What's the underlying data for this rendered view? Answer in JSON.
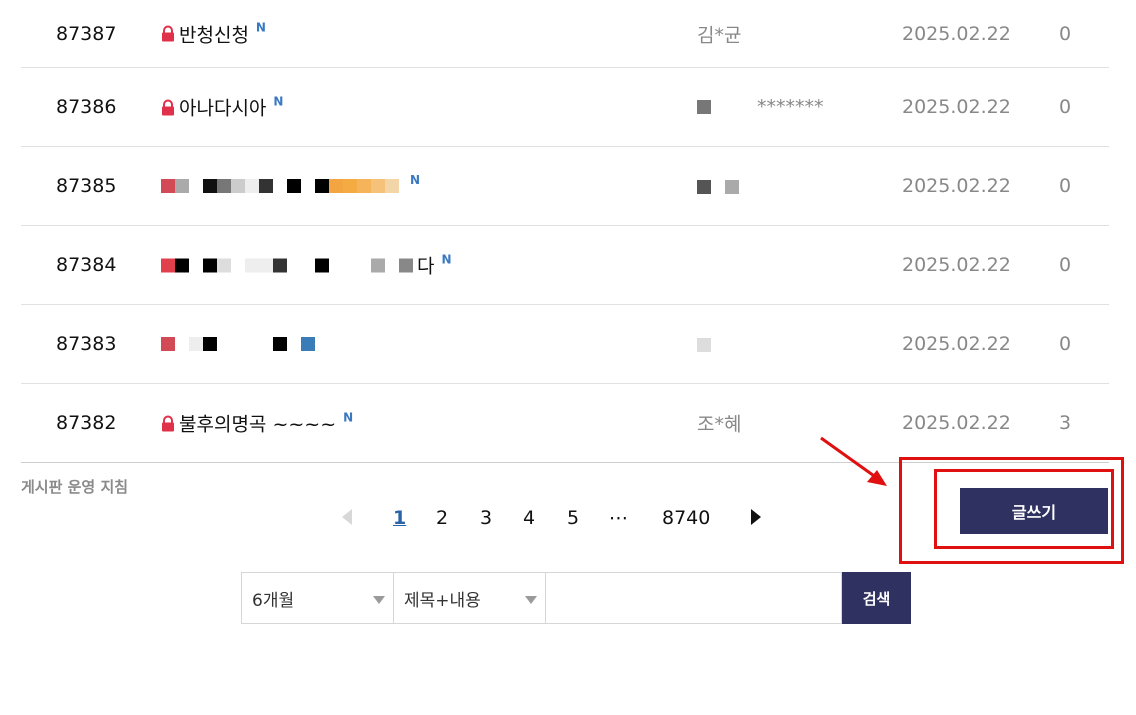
{
  "posts": [
    {
      "number": "87387",
      "title": "반청신청",
      "author": "김*균",
      "date": "2025.02.22",
      "views": "0",
      "locked": true,
      "is_new": true,
      "badge": "N"
    },
    {
      "number": "87386",
      "title": "아나다시아",
      "author": "*******",
      "date": "2025.02.22",
      "views": "0",
      "locked": true,
      "is_new": true,
      "badge": "N"
    },
    {
      "number": "87385",
      "title": "",
      "author": "",
      "date": "2025.02.22",
      "views": "0",
      "locked": false,
      "is_new": true,
      "badge": "N"
    },
    {
      "number": "87384",
      "title": "다",
      "author": "",
      "date": "2025.02.22",
      "views": "0",
      "locked": false,
      "is_new": true,
      "badge": "N"
    },
    {
      "number": "87383",
      "title": "",
      "author": "",
      "date": "2025.02.22",
      "views": "0",
      "locked": false,
      "is_new": false,
      "badge": ""
    },
    {
      "number": "87382",
      "title": "불후의명곡 ~~~~",
      "author": "조*혜",
      "date": "2025.02.22",
      "views": "3",
      "locked": true,
      "is_new": true,
      "badge": "N"
    }
  ],
  "guide_link": "게시판 운영 지침",
  "pagination": {
    "pages": [
      "1",
      "2",
      "3",
      "4",
      "5"
    ],
    "ellipsis": "⋯",
    "last_page": "8740",
    "current": "1"
  },
  "write_button": "글쓰기",
  "search": {
    "period": "6개월",
    "field": "제목+내용",
    "query": "",
    "button": "검색"
  },
  "colors": {
    "accent_navy": "#2f3160",
    "new_badge": "#3a79c1",
    "lock_red": "#e0304a",
    "highlight_red": "#e01010"
  }
}
